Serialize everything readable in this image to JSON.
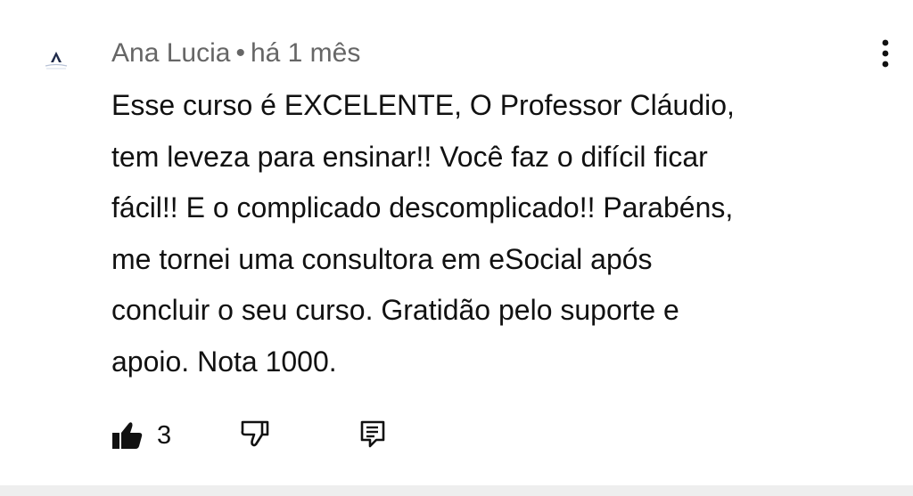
{
  "comment": {
    "author": "Ana Lucia",
    "separator": "•",
    "time": "há 1 mês",
    "text_lines": [
      "Esse curso é EXCELENTE, O Professor Cláudio,",
      "tem leveza para ensinar!! Você faz o difícil ficar",
      "fácil!! E o complicado descomplicado!! Parabéns,",
      "me tornei uma consultora em eSocial após",
      "concluir o seu curso. Gratidão pelo suporte e",
      "apoio. Nota 1000."
    ],
    "like_count": "3"
  },
  "icons": {
    "avatar": "avatar-logo",
    "more": "more-vert-icon",
    "like": "thumb-up-filled-icon",
    "dislike": "thumb-down-outline-icon",
    "reply": "comment-reply-icon"
  },
  "colors": {
    "meta_text": "#666666",
    "body_text": "#111111",
    "bottom_strip": "#eeeeee"
  }
}
